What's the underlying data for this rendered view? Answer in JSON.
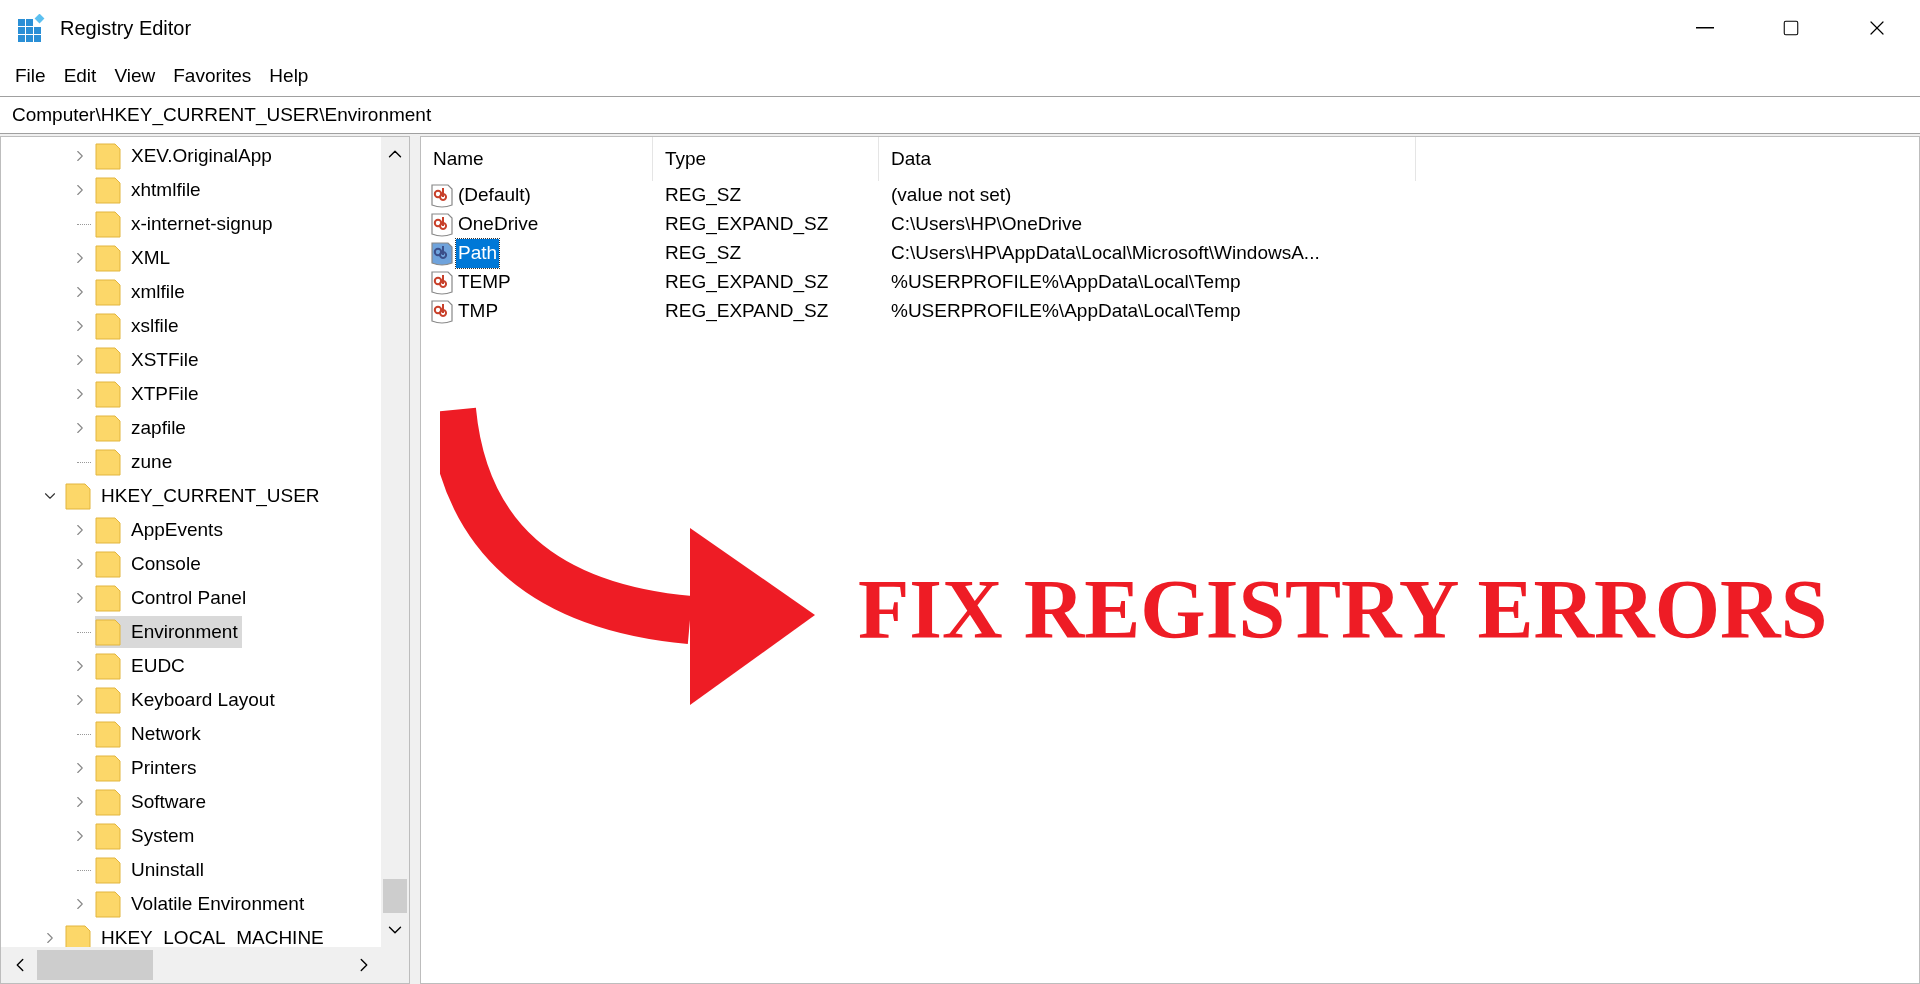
{
  "window": {
    "title": "Registry Editor"
  },
  "menu": [
    "File",
    "Edit",
    "View",
    "Favorites",
    "Help"
  ],
  "address": "Computer\\HKEY_CURRENT_USER\\Environment",
  "tree": {
    "continued_children": [
      {
        "label": "XEV.OriginalApp",
        "expandable": true,
        "selected": false
      },
      {
        "label": "xhtmlfile",
        "expandable": true,
        "selected": false
      },
      {
        "label": "x-internet-signup",
        "expandable": false,
        "selected": false
      },
      {
        "label": "XML",
        "expandable": true,
        "selected": false
      },
      {
        "label": "xmlfile",
        "expandable": true,
        "selected": false
      },
      {
        "label": "xslfile",
        "expandable": true,
        "selected": false
      },
      {
        "label": "XSTFile",
        "expandable": true,
        "selected": false
      },
      {
        "label": "XTPFile",
        "expandable": true,
        "selected": false
      },
      {
        "label": "zapfile",
        "expandable": true,
        "selected": false
      },
      {
        "label": "zune",
        "expandable": false,
        "selected": false
      }
    ],
    "roots": [
      {
        "label": "HKEY_CURRENT_USER",
        "expandable": true,
        "expanded": true,
        "selected": false,
        "children": [
          {
            "label": "AppEvents",
            "expandable": true,
            "selected": false
          },
          {
            "label": "Console",
            "expandable": true,
            "selected": false
          },
          {
            "label": "Control Panel",
            "expandable": true,
            "selected": false
          },
          {
            "label": "Environment",
            "expandable": false,
            "selected": true
          },
          {
            "label": "EUDC",
            "expandable": true,
            "selected": false
          },
          {
            "label": "Keyboard Layout",
            "expandable": true,
            "selected": false
          },
          {
            "label": "Network",
            "expandable": false,
            "selected": false
          },
          {
            "label": "Printers",
            "expandable": true,
            "selected": false
          },
          {
            "label": "Software",
            "expandable": true,
            "selected": false
          },
          {
            "label": "System",
            "expandable": true,
            "selected": false
          },
          {
            "label": "Uninstall",
            "expandable": false,
            "selected": false
          },
          {
            "label": "Volatile Environment",
            "expandable": true,
            "selected": false
          }
        ]
      },
      {
        "label": "HKEY_LOCAL_MACHINE",
        "expandable": true,
        "selected": false
      }
    ]
  },
  "values": {
    "columns": [
      "Name",
      "Type",
      "Data"
    ],
    "rows": [
      {
        "name": "(Default)",
        "type": "REG_SZ",
        "data": "(value not set)",
        "selected": false
      },
      {
        "name": "OneDrive",
        "type": "REG_EXPAND_SZ",
        "data": "C:\\Users\\HP\\OneDrive",
        "selected": false
      },
      {
        "name": "Path",
        "type": "REG_SZ",
        "data": "C:\\Users\\HP\\AppData\\Local\\Microsoft\\WindowsA...",
        "selected": true
      },
      {
        "name": "TEMP",
        "type": "REG_EXPAND_SZ",
        "data": "%USERPROFILE%\\AppData\\Local\\Temp",
        "selected": false
      },
      {
        "name": "TMP",
        "type": "REG_EXPAND_SZ",
        "data": "%USERPROFILE%\\AppData\\Local\\Temp",
        "selected": false
      }
    ]
  },
  "overlay": {
    "headline": "FIX REGISTRY ERRORS"
  }
}
